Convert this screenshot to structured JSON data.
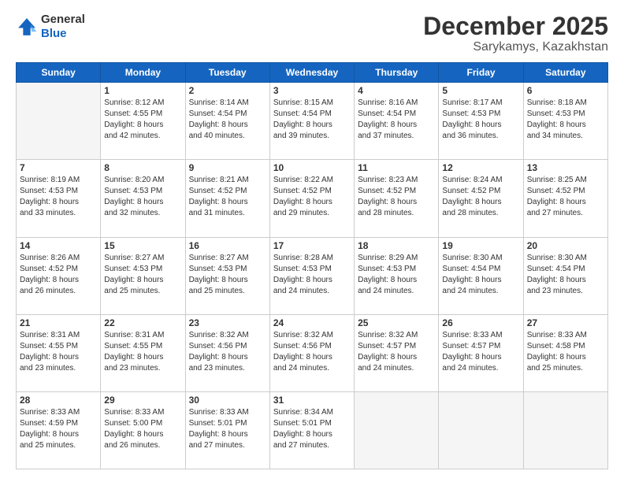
{
  "header": {
    "logo_line1": "General",
    "logo_line2": "Blue",
    "month": "December 2025",
    "location": "Sarykamys, Kazakhstan"
  },
  "weekdays": [
    "Sunday",
    "Monday",
    "Tuesday",
    "Wednesday",
    "Thursday",
    "Friday",
    "Saturday"
  ],
  "weeks": [
    [
      {
        "day": "",
        "info": ""
      },
      {
        "day": "1",
        "info": "Sunrise: 8:12 AM\nSunset: 4:55 PM\nDaylight: 8 hours\nand 42 minutes."
      },
      {
        "day": "2",
        "info": "Sunrise: 8:14 AM\nSunset: 4:54 PM\nDaylight: 8 hours\nand 40 minutes."
      },
      {
        "day": "3",
        "info": "Sunrise: 8:15 AM\nSunset: 4:54 PM\nDaylight: 8 hours\nand 39 minutes."
      },
      {
        "day": "4",
        "info": "Sunrise: 8:16 AM\nSunset: 4:54 PM\nDaylight: 8 hours\nand 37 minutes."
      },
      {
        "day": "5",
        "info": "Sunrise: 8:17 AM\nSunset: 4:53 PM\nDaylight: 8 hours\nand 36 minutes."
      },
      {
        "day": "6",
        "info": "Sunrise: 8:18 AM\nSunset: 4:53 PM\nDaylight: 8 hours\nand 34 minutes."
      }
    ],
    [
      {
        "day": "7",
        "info": "Sunrise: 8:19 AM\nSunset: 4:53 PM\nDaylight: 8 hours\nand 33 minutes."
      },
      {
        "day": "8",
        "info": "Sunrise: 8:20 AM\nSunset: 4:53 PM\nDaylight: 8 hours\nand 32 minutes."
      },
      {
        "day": "9",
        "info": "Sunrise: 8:21 AM\nSunset: 4:52 PM\nDaylight: 8 hours\nand 31 minutes."
      },
      {
        "day": "10",
        "info": "Sunrise: 8:22 AM\nSunset: 4:52 PM\nDaylight: 8 hours\nand 29 minutes."
      },
      {
        "day": "11",
        "info": "Sunrise: 8:23 AM\nSunset: 4:52 PM\nDaylight: 8 hours\nand 28 minutes."
      },
      {
        "day": "12",
        "info": "Sunrise: 8:24 AM\nSunset: 4:52 PM\nDaylight: 8 hours\nand 28 minutes."
      },
      {
        "day": "13",
        "info": "Sunrise: 8:25 AM\nSunset: 4:52 PM\nDaylight: 8 hours\nand 27 minutes."
      }
    ],
    [
      {
        "day": "14",
        "info": "Sunrise: 8:26 AM\nSunset: 4:52 PM\nDaylight: 8 hours\nand 26 minutes."
      },
      {
        "day": "15",
        "info": "Sunrise: 8:27 AM\nSunset: 4:53 PM\nDaylight: 8 hours\nand 25 minutes."
      },
      {
        "day": "16",
        "info": "Sunrise: 8:27 AM\nSunset: 4:53 PM\nDaylight: 8 hours\nand 25 minutes."
      },
      {
        "day": "17",
        "info": "Sunrise: 8:28 AM\nSunset: 4:53 PM\nDaylight: 8 hours\nand 24 minutes."
      },
      {
        "day": "18",
        "info": "Sunrise: 8:29 AM\nSunset: 4:53 PM\nDaylight: 8 hours\nand 24 minutes."
      },
      {
        "day": "19",
        "info": "Sunrise: 8:30 AM\nSunset: 4:54 PM\nDaylight: 8 hours\nand 24 minutes."
      },
      {
        "day": "20",
        "info": "Sunrise: 8:30 AM\nSunset: 4:54 PM\nDaylight: 8 hours\nand 23 minutes."
      }
    ],
    [
      {
        "day": "21",
        "info": "Sunrise: 8:31 AM\nSunset: 4:55 PM\nDaylight: 8 hours\nand 23 minutes."
      },
      {
        "day": "22",
        "info": "Sunrise: 8:31 AM\nSunset: 4:55 PM\nDaylight: 8 hours\nand 23 minutes."
      },
      {
        "day": "23",
        "info": "Sunrise: 8:32 AM\nSunset: 4:56 PM\nDaylight: 8 hours\nand 23 minutes."
      },
      {
        "day": "24",
        "info": "Sunrise: 8:32 AM\nSunset: 4:56 PM\nDaylight: 8 hours\nand 24 minutes."
      },
      {
        "day": "25",
        "info": "Sunrise: 8:32 AM\nSunset: 4:57 PM\nDaylight: 8 hours\nand 24 minutes."
      },
      {
        "day": "26",
        "info": "Sunrise: 8:33 AM\nSunset: 4:57 PM\nDaylight: 8 hours\nand 24 minutes."
      },
      {
        "day": "27",
        "info": "Sunrise: 8:33 AM\nSunset: 4:58 PM\nDaylight: 8 hours\nand 25 minutes."
      }
    ],
    [
      {
        "day": "28",
        "info": "Sunrise: 8:33 AM\nSunset: 4:59 PM\nDaylight: 8 hours\nand 25 minutes."
      },
      {
        "day": "29",
        "info": "Sunrise: 8:33 AM\nSunset: 5:00 PM\nDaylight: 8 hours\nand 26 minutes."
      },
      {
        "day": "30",
        "info": "Sunrise: 8:33 AM\nSunset: 5:01 PM\nDaylight: 8 hours\nand 27 minutes."
      },
      {
        "day": "31",
        "info": "Sunrise: 8:34 AM\nSunset: 5:01 PM\nDaylight: 8 hours\nand 27 minutes."
      },
      {
        "day": "",
        "info": ""
      },
      {
        "day": "",
        "info": ""
      },
      {
        "day": "",
        "info": ""
      }
    ]
  ]
}
